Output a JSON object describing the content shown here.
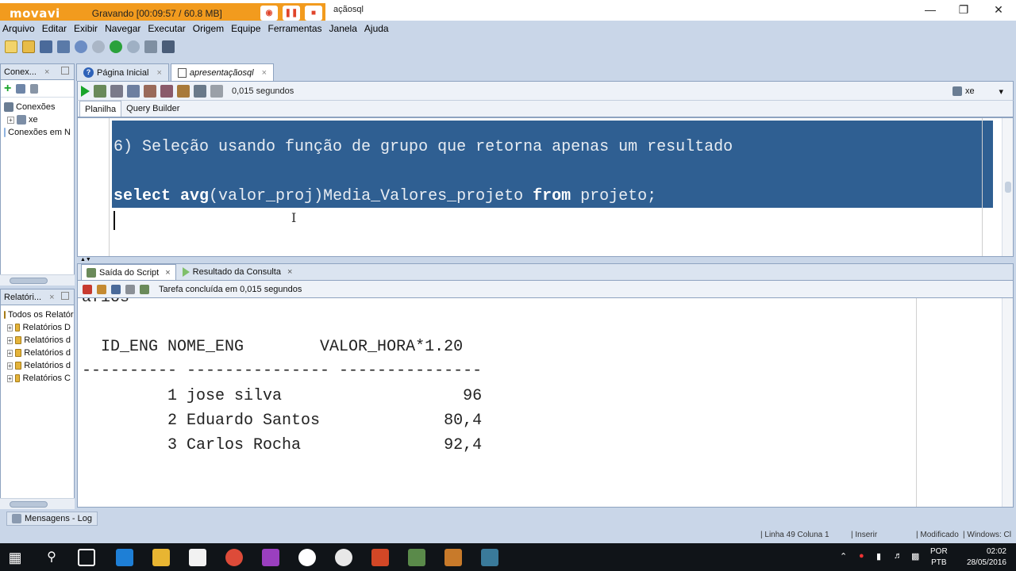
{
  "recorder": {
    "logo": "movavi",
    "status": "Gravando  [00:09:57 / 60.8 MB]"
  },
  "window": {
    "title": "açãosql"
  },
  "menu": [
    {
      "label": "Arquivo"
    },
    {
      "label": "Editar"
    },
    {
      "label": "Exibir"
    },
    {
      "label": "Navegar"
    },
    {
      "label": "Executar"
    },
    {
      "label": "Origem"
    },
    {
      "label": "Equipe"
    },
    {
      "label": "Ferramentas"
    },
    {
      "label": "Janela"
    },
    {
      "label": "Ajuda"
    }
  ],
  "connections_panel": {
    "tab": "Conex...",
    "tree": {
      "root": "Conexões",
      "child": "xe",
      "other": "Conexões em N"
    }
  },
  "reports_panel": {
    "tab": "Relatóri...",
    "items": [
      "Todos os Relatór",
      "Relatórios D",
      "Relatórios d",
      "Relatórios d",
      "Relatórios d",
      "Relatórios C"
    ]
  },
  "doc_tabs": {
    "home": "Página Inicial",
    "active": "apresentaçãosql"
  },
  "editor_toolbar": {
    "elapsed": "0,015 segundos",
    "connection": "xe"
  },
  "editor_subtabs": {
    "worksheet": "Planilha",
    "query_builder": "Query Builder"
  },
  "editor": {
    "comment_line": "6) Seleção usando função de grupo que retorna apenas um resultado",
    "kw_select": "select",
    "kw_avg": "avg",
    "expr": "(valor_proj)Media_Valores_projeto ",
    "kw_from": "from",
    "table": " projeto;"
  },
  "output_tabs": {
    "script": "Saída do Script",
    "results": "Resultado da Consulta"
  },
  "output_status": "Tarefa concluída em 0,015 segundos",
  "output": {
    "partial": "afios",
    "header": "  ID_ENG NOME_ENG        VALOR_HORA*1.20",
    "divider": "---------- --------------- ---------------",
    "rows": [
      "         1 jose silva                   96",
      "         2 Eduardo Santos             80,4",
      "         3 Carlos Rocha               92,4"
    ]
  },
  "messages_tab": "Mensagens - Log",
  "statusbar": {
    "position": "Linha 49 Coluna 1",
    "mode": "Inserir",
    "modified": "Modificado",
    "platform": "Windows: Cl"
  },
  "taskbar": {
    "lang1": "POR",
    "lang2": "PTB",
    "time": "02:02",
    "date": "28/05/2016"
  }
}
